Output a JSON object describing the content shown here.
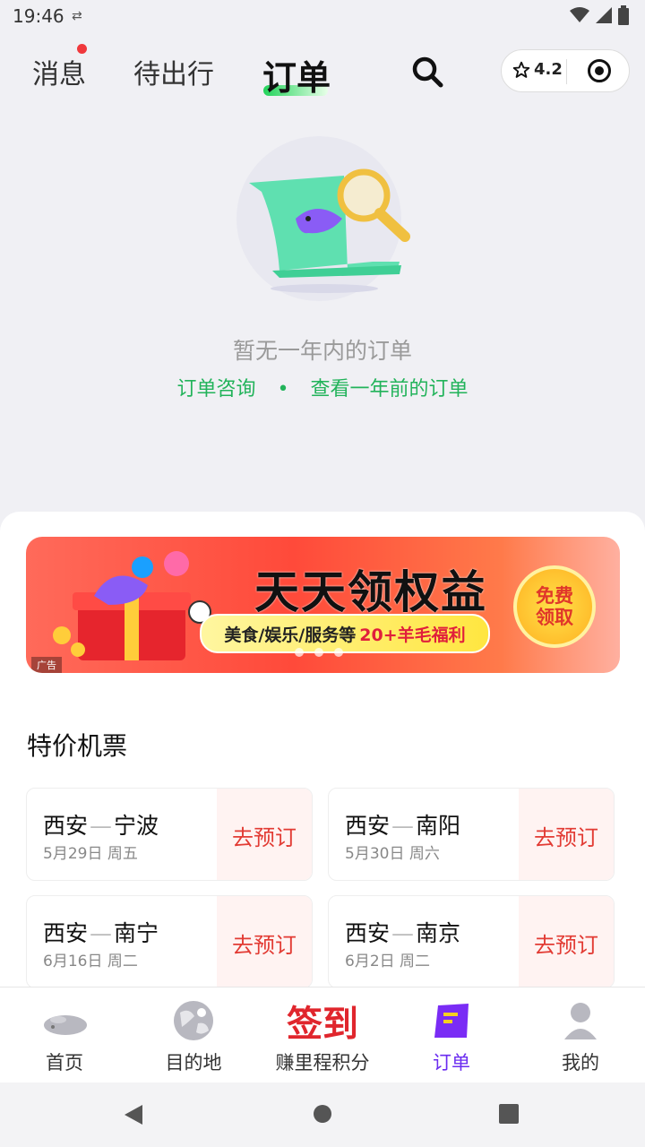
{
  "status": {
    "time": "19:46"
  },
  "header": {
    "tabs": [
      "消息",
      "待出行",
      "订单"
    ],
    "rating": "4.2"
  },
  "empty": {
    "message": "暂无一年内的订单",
    "link1": "订单咨询",
    "dot": "•",
    "link2": "查看一年前的订单"
  },
  "banner": {
    "title": "天天领权益",
    "subtitle": "美食/娱乐/服务等",
    "highlight": "20+羊毛福利",
    "cta_line1": "免费",
    "cta_line2": "领取",
    "ad_label": "广告"
  },
  "flights": {
    "title": "特价机票",
    "book_label": "去预订",
    "items": [
      {
        "from": "西安",
        "to": "宁波",
        "date": "5月29日 周五"
      },
      {
        "from": "西安",
        "to": "南阳",
        "date": "5月30日 周六"
      },
      {
        "from": "西安",
        "to": "南宁",
        "date": "6月16日 周二"
      },
      {
        "from": "西安",
        "to": "南京",
        "date": "6月2日 周二"
      }
    ]
  },
  "tabbar": {
    "items": [
      "首页",
      "目的地",
      "赚里程积分",
      "订单",
      "我的"
    ],
    "checkin": "签到"
  },
  "colors": {
    "accent_green": "#22b35a",
    "accent_purple": "#6b2cf0",
    "book_red": "#e23b34"
  }
}
